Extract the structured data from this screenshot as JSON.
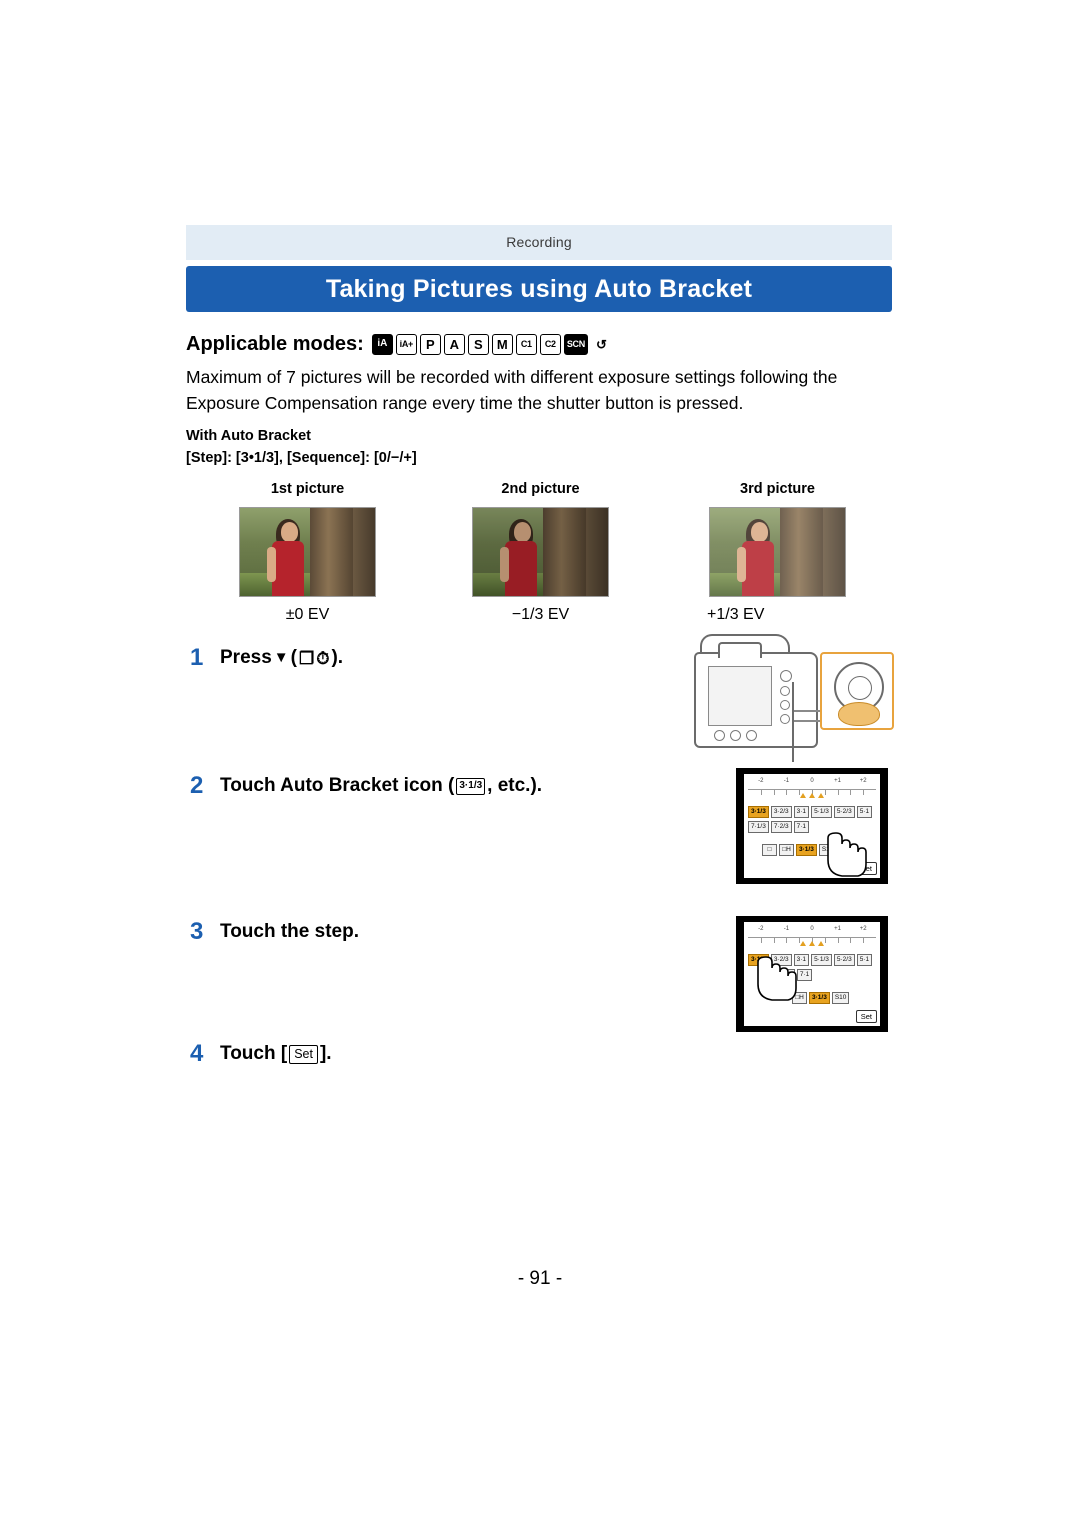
{
  "page": {
    "section_label": "Recording",
    "title": "Taking Pictures using Auto Bracket",
    "page_number": "- 91 -"
  },
  "applicable_modes": {
    "label": "Applicable modes:",
    "icons": [
      {
        "name": "intelligent-auto-icon",
        "text": "iA",
        "style": "filled"
      },
      {
        "name": "intelligent-auto-plus-icon",
        "text": "iA+",
        "style": "outline"
      },
      {
        "name": "program-ae-icon",
        "text": "P",
        "style": "outline"
      },
      {
        "name": "aperture-priority-icon",
        "text": "A",
        "style": "outline"
      },
      {
        "name": "shutter-priority-icon",
        "text": "S",
        "style": "outline"
      },
      {
        "name": "manual-exposure-icon",
        "text": "M",
        "style": "outline"
      },
      {
        "name": "custom-c1-icon",
        "text": "C1",
        "style": "outline"
      },
      {
        "name": "custom-c2-icon",
        "text": "C2",
        "style": "outline"
      },
      {
        "name": "scene-mode-icon",
        "text": "SCN",
        "style": "filled"
      },
      {
        "name": "creative-control-icon",
        "text": "↺",
        "style": "plain"
      }
    ]
  },
  "intro": "Maximum of 7 pictures will be recorded with different exposure settings following the Exposure Compensation range every time the shutter button is pressed.",
  "auto_bracket_example": {
    "heading": "With Auto Bracket",
    "params": "[Step]: [3•1/3], [Sequence]: [0/−/+]",
    "pictures": [
      {
        "caption": "1st picture",
        "ev": "±0 EV",
        "shade": "none"
      },
      {
        "caption": "2nd picture",
        "ev": "−1/3 EV",
        "shade": "dark"
      },
      {
        "caption": "3rd picture",
        "ev": "+1/3 EV",
        "shade": "light"
      }
    ]
  },
  "steps": [
    {
      "number": "1",
      "text_before": "Press",
      "arrow": "▼",
      "paren_open": "(",
      "icon_burst": "❐",
      "icon_timer": "⏱",
      "paren_close": ").",
      "text_after": ""
    },
    {
      "number": "2",
      "text_before": "Touch Auto Bracket icon (",
      "icon_label": "3·1/3",
      "text_after": ", etc.)."
    },
    {
      "number": "3",
      "text_before": "Touch the step.",
      "text_after": ""
    },
    {
      "number": "4",
      "text_before": "Touch [",
      "set_label": "Set",
      "text_after": "]."
    }
  ],
  "lcd_step2": {
    "scale_numbers": [
      "-2",
      "-1",
      "0",
      "+1",
      "+2"
    ],
    "row1": [
      "3·1/3",
      "3·2/3",
      "3·1",
      "5·1/3",
      "5·2/3",
      "5·1"
    ],
    "row2": [
      "7·1/3",
      "7·2/3",
      "7·1"
    ],
    "row3": [
      "□",
      "□H",
      "3·1/3",
      "S10"
    ],
    "selected": "3·1/3",
    "set_label": "Set"
  },
  "lcd_step3": {
    "scale_numbers": [
      "-2",
      "-1",
      "0",
      "+1",
      "+2"
    ],
    "row1": [
      "3·1/3",
      "3·2/3",
      "3·1",
      "5·1/3",
      "5·2/3",
      "5·1"
    ],
    "row2": [
      "7·2/3",
      "7·1"
    ],
    "row3": [
      "□H",
      "3·1/3",
      "S10"
    ],
    "selected": "3·1/3",
    "set_label": "Set"
  },
  "camera_illustration": {
    "name": "camera-rear-cursor-dial",
    "highlight_color": "#e8a33d",
    "thumb_color": "#f0c070"
  }
}
